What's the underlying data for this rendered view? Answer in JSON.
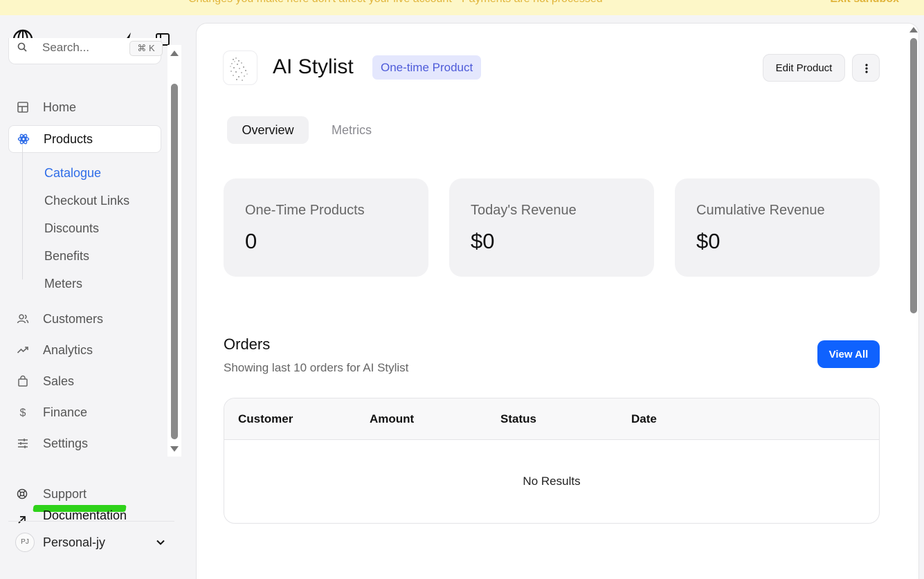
{
  "banner": {
    "message": "Changes you make here don't affect your live account - Payments are not processed",
    "exit_label": "Exit sandbox"
  },
  "search": {
    "placeholder": "Search...",
    "shortcut": "⌘ K"
  },
  "nav": {
    "items": [
      {
        "label": "Home",
        "icon": "home-icon"
      },
      {
        "label": "Products",
        "icon": "products-icon",
        "active": true
      },
      {
        "label": "Customers",
        "icon": "customers-icon"
      },
      {
        "label": "Analytics",
        "icon": "analytics-icon"
      },
      {
        "label": "Sales",
        "icon": "sales-icon"
      },
      {
        "label": "Finance",
        "icon": "finance-icon"
      },
      {
        "label": "Settings",
        "icon": "settings-icon"
      }
    ],
    "sub_items": [
      "Catalogue",
      "Checkout Links",
      "Discounts",
      "Benefits",
      "Meters"
    ],
    "active_sub": "Catalogue"
  },
  "footer": {
    "support": "Support",
    "documentation": "Documentation",
    "account_initials": "PJ",
    "account_name": "Personal-jy"
  },
  "product": {
    "name": "AI Stylist",
    "type_badge": "One-time Product",
    "edit_label": "Edit Product"
  },
  "tabs": [
    "Overview",
    "Metrics"
  ],
  "active_tab": "Overview",
  "stats": [
    {
      "label": "One-Time Products",
      "value": "0"
    },
    {
      "label": "Today's Revenue",
      "value": "$0"
    },
    {
      "label": "Cumulative Revenue",
      "value": "$0"
    }
  ],
  "orders": {
    "title": "Orders",
    "subtitle": "Showing last 10 orders for AI Stylist",
    "view_all": "View All",
    "columns": [
      "Customer",
      "Amount",
      "Status",
      "Date"
    ],
    "empty_text": "No Results"
  },
  "colors": {
    "accent": "#0f62fe",
    "active_sub": "#2f6de8",
    "badge_bg": "#e4e7fd",
    "badge_text": "#4e5bd9",
    "banner_bg": "#fdf7c8",
    "banner_text": "#e0b43a",
    "highlight": "#2fd21a"
  }
}
